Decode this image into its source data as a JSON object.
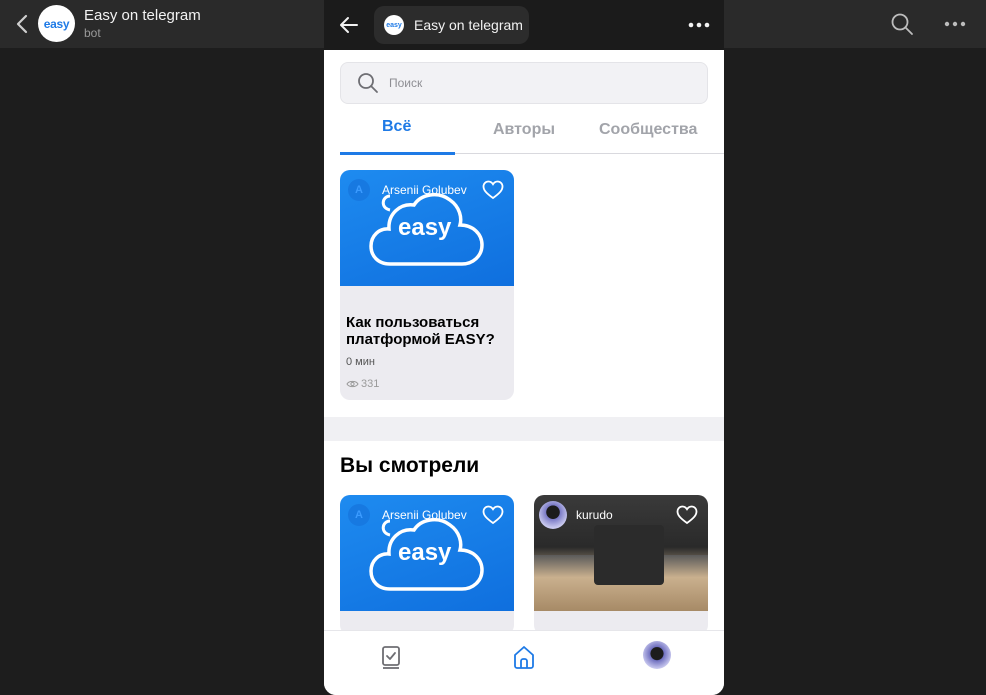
{
  "telegram": {
    "bot_name": "Easy on telegram",
    "bot_subtitle": "bot",
    "avatar_text": "easy"
  },
  "miniapp": {
    "title": "Easy on telegram",
    "logo_text": "easy"
  },
  "search": {
    "placeholder": "Поиск"
  },
  "tabs": [
    {
      "label": "Всё",
      "active": true
    },
    {
      "label": "Авторы",
      "active": false
    },
    {
      "label": "Сообщества",
      "active": false
    }
  ],
  "feed": [
    {
      "author": "Arsenii Golubev",
      "author_initial": "A",
      "cover_text": "easy",
      "title": "Как пользоваться платформой EASY?",
      "duration": "0 мин",
      "views": "331"
    }
  ],
  "watched": {
    "heading": "Вы смотрели",
    "cards": [
      {
        "author": "Arsenii Golubev",
        "author_initial": "A",
        "cover_text": "easy"
      },
      {
        "author": "kurudo"
      }
    ]
  },
  "bottom_nav": {
    "items": [
      {
        "icon": "checklist-icon",
        "active": false
      },
      {
        "icon": "home-icon",
        "active": true
      },
      {
        "icon": "profile-avatar",
        "active": false
      }
    ]
  },
  "colors": {
    "accent": "#1e7ae6",
    "brand_blue": "#1e8bf0",
    "telegram_bar": "#2a2a2a",
    "background": "#1d1d1d"
  }
}
